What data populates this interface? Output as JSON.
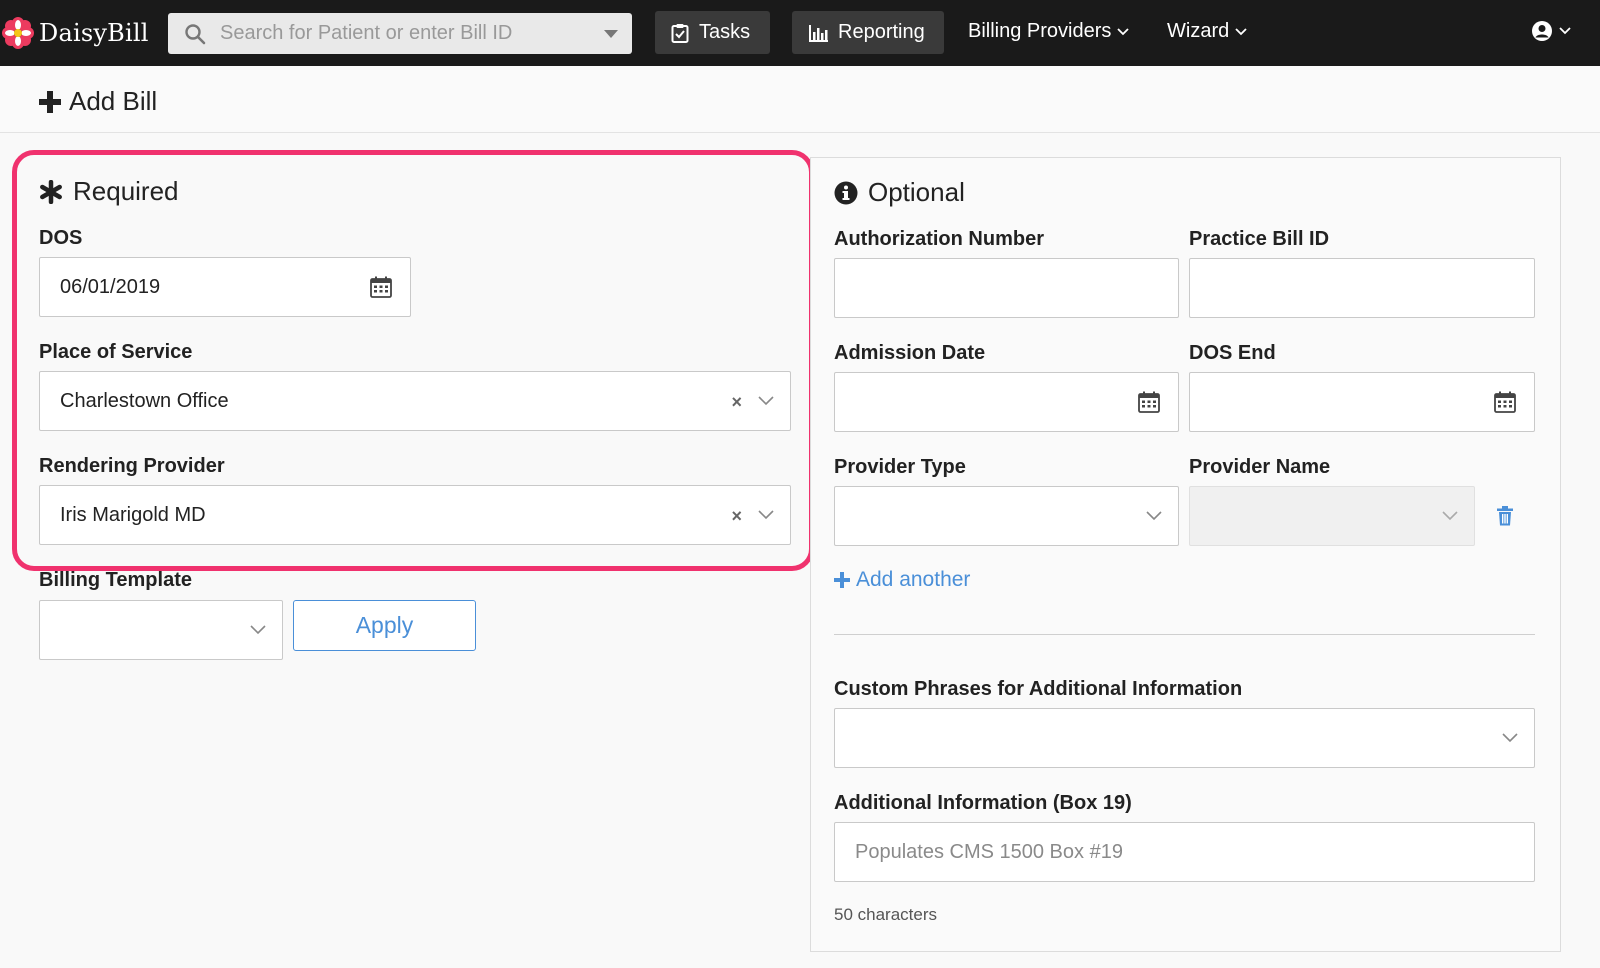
{
  "navbar": {
    "brand": "DaisyBill",
    "search_placeholder": "Search for Patient or enter Bill ID",
    "tasks_label": "Tasks",
    "reporting_label": "Reporting",
    "billing_providers_label": "Billing Providers",
    "wizard_label": "Wizard"
  },
  "page": {
    "title": "Add Bill"
  },
  "required": {
    "title": "Required",
    "dos_label": "DOS",
    "dos_value": "06/01/2019",
    "place_label": "Place of Service",
    "place_value": "Charlestown Office",
    "provider_label": "Rendering Provider",
    "provider_value": "Iris Marigold MD",
    "clear_glyph": "×"
  },
  "billing_template": {
    "label": "Billing Template",
    "apply_label": "Apply"
  },
  "optional": {
    "title": "Optional",
    "auth_label": "Authorization Number",
    "practice_label": "Practice Bill ID",
    "admission_label": "Admission Date",
    "dos_end_label": "DOS End",
    "provider_type_label": "Provider Type",
    "provider_name_label": "Provider Name",
    "add_another_label": "Add another",
    "custom_phrases_label": "Custom Phrases for Additional Information",
    "additional_info_label": "Additional Information (Box 19)",
    "additional_info_placeholder": "Populates CMS 1500 Box #19",
    "char_count": "50 characters"
  },
  "colors": {
    "navbar_bg": "#1a1a1a",
    "highlight": "#f0326e",
    "link_blue": "#4a8fd8"
  },
  "icons": [
    "daisy-logo-icon",
    "search-icon",
    "clipboard-icon",
    "bar-chart-icon",
    "chevron-down-icon",
    "user-icon",
    "plus-icon",
    "asterisk-icon",
    "info-icon",
    "calendar-icon",
    "clear-icon",
    "trash-icon"
  ]
}
